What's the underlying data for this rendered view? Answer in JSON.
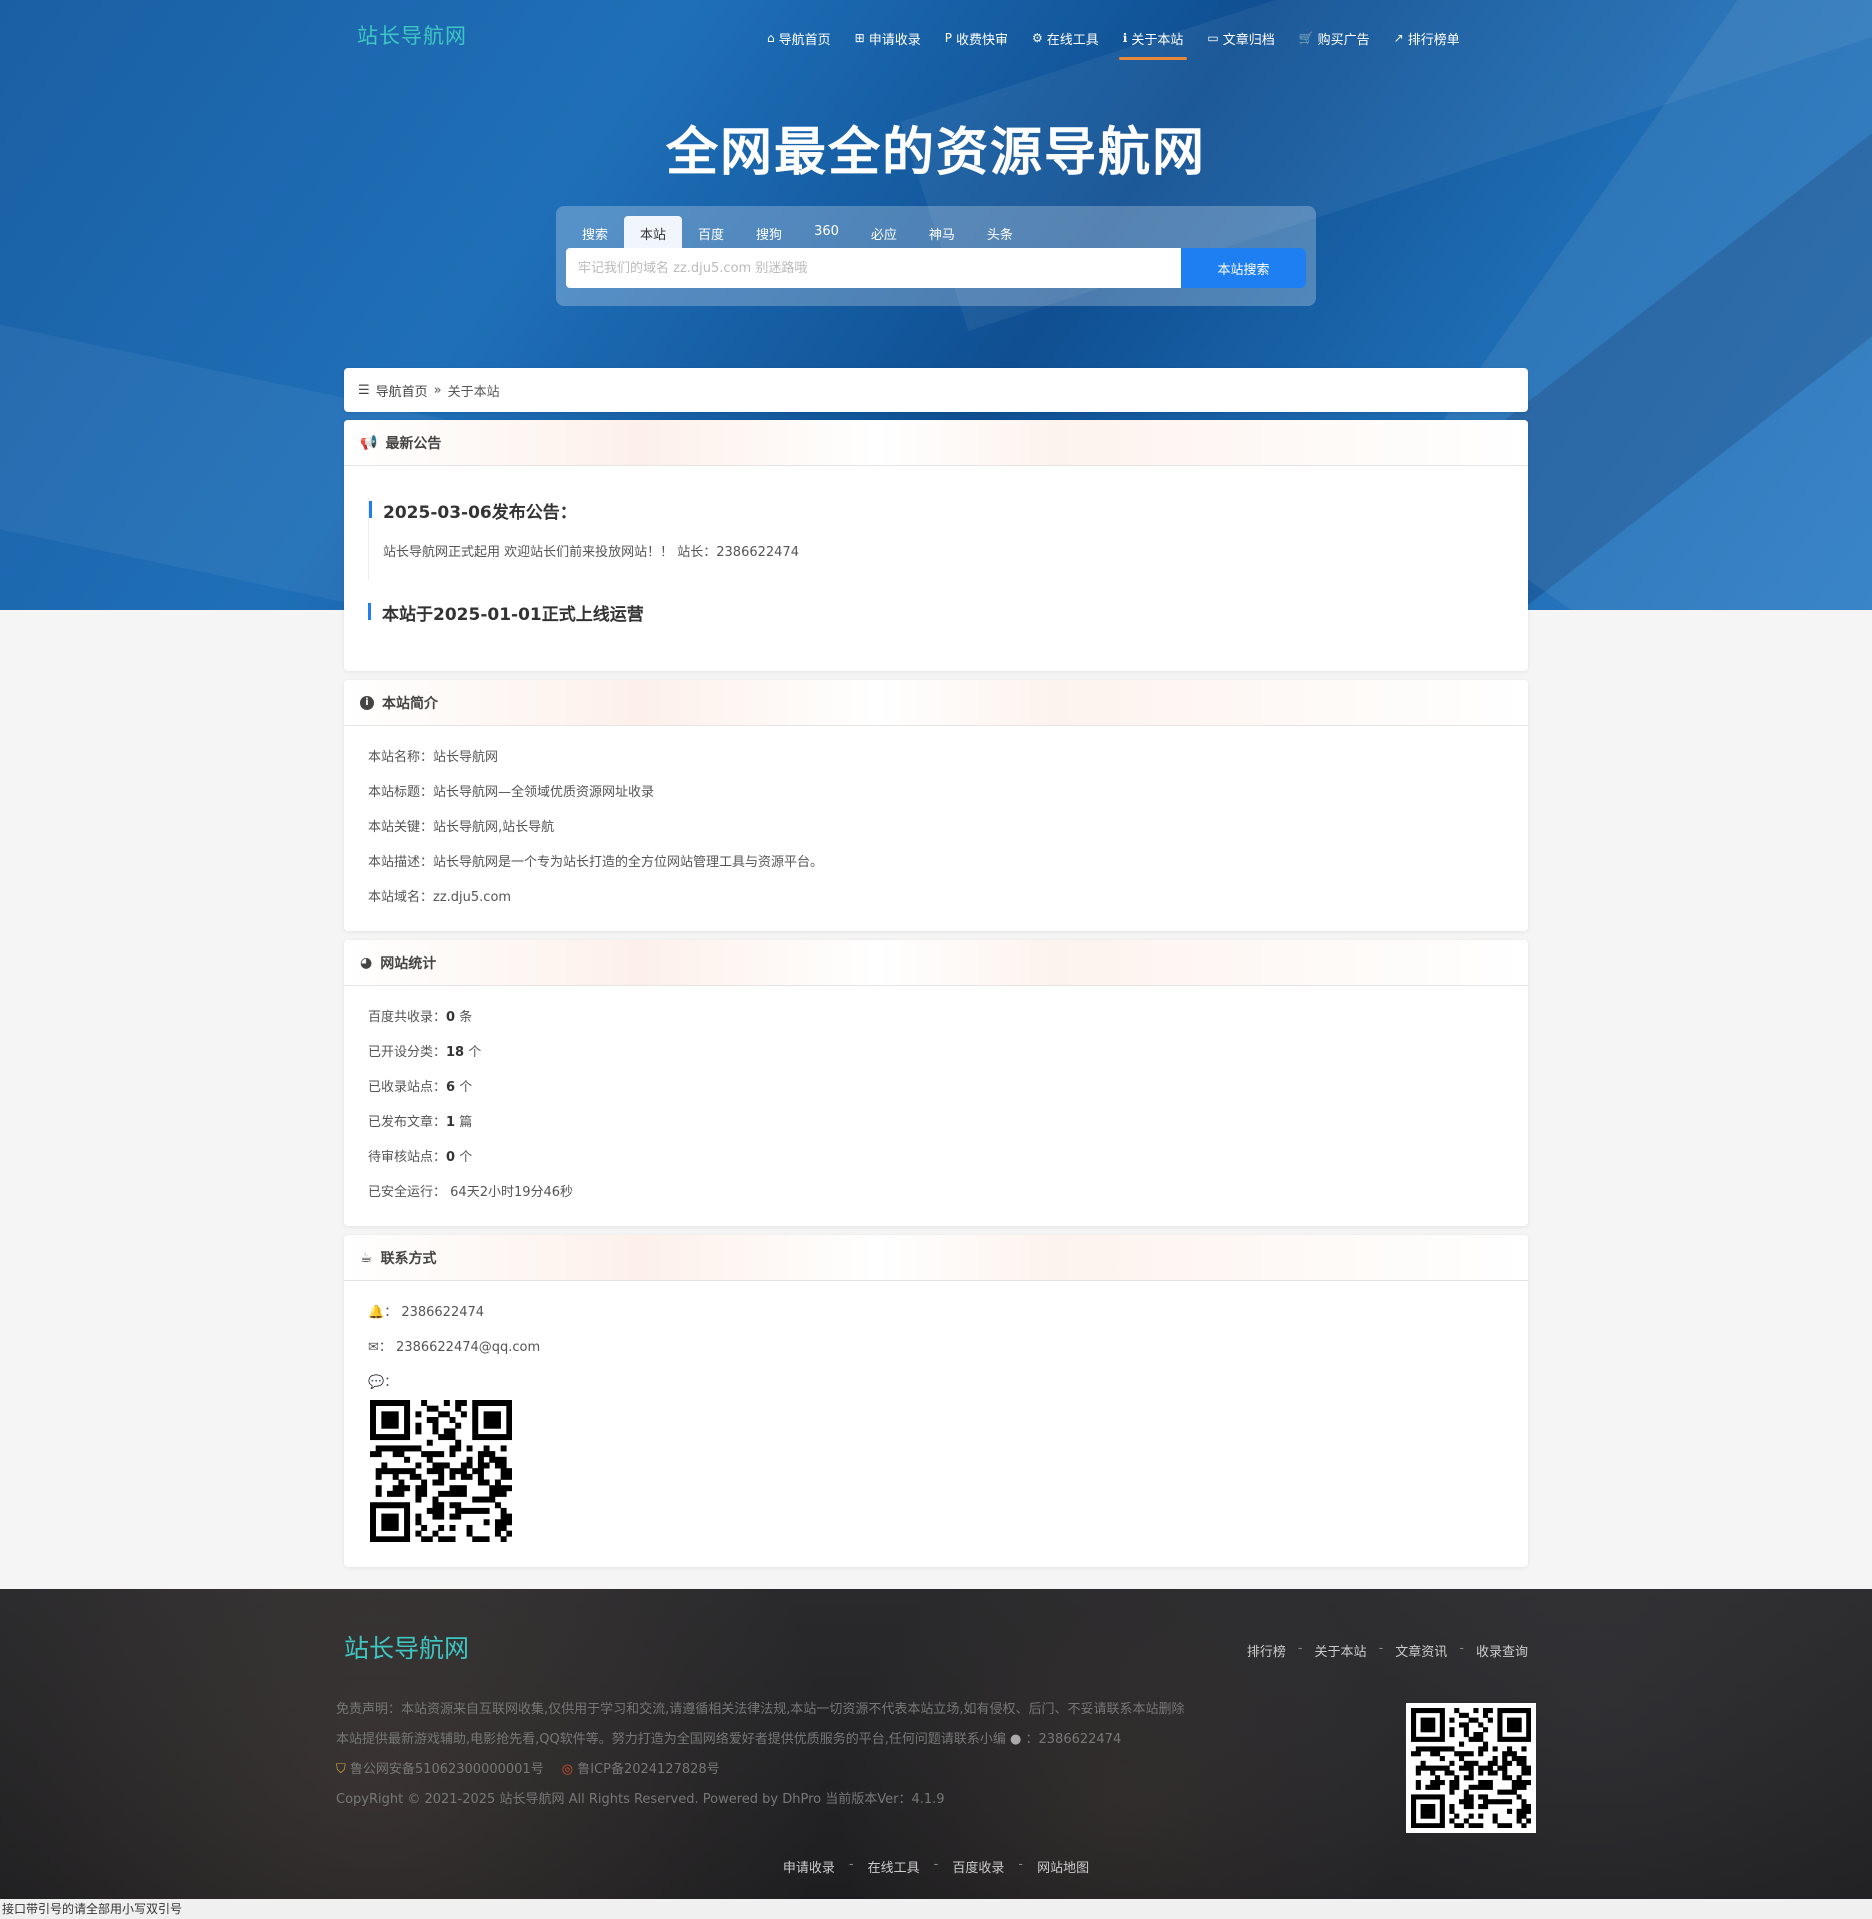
{
  "header": {
    "logo": "站长导航网",
    "nav": [
      {
        "icon": "home-icon",
        "glyph": "⌂",
        "label": "导航首页"
      },
      {
        "icon": "plus-square-icon",
        "glyph": "⊞",
        "label": "申请收录"
      },
      {
        "icon": "paypal-icon",
        "glyph": "P",
        "label": "收费快审"
      },
      {
        "icon": "gears-icon",
        "glyph": "⚙",
        "label": "在线工具"
      },
      {
        "icon": "info-circle-icon",
        "glyph": "ℹ",
        "label": "关于本站"
      },
      {
        "icon": "folder-open-icon",
        "glyph": "▭",
        "label": "文章归档"
      },
      {
        "icon": "cart-icon",
        "glyph": "🛒",
        "label": "购买广告"
      },
      {
        "icon": "line-chart-icon",
        "glyph": "↗",
        "label": "排行榜单"
      }
    ]
  },
  "hero": {
    "title": "全网最全的资源导航网"
  },
  "search": {
    "tabs": [
      "搜索",
      "本站",
      "百度",
      "搜狗",
      "360",
      "必应",
      "神马",
      "头条"
    ],
    "placeholder": "牢记我们的域名 zz.dju5.com 别迷路哦",
    "button": "本站搜索"
  },
  "breadcrumb": {
    "home": "导航首页",
    "sep": "»",
    "current": "关于本站"
  },
  "notice": {
    "title": "最新公告",
    "items": [
      {
        "heading": "2025-03-06发布公告：",
        "text": "站长导航网正式起用 欢迎站长们前来投放网站！！ 站长：2386622474"
      },
      {
        "heading": "本站于2025-01-01正式上线运营",
        "text": ""
      }
    ]
  },
  "intro": {
    "title": "本站简介",
    "lines": [
      {
        "label": "本站名称：",
        "value": "站长导航网"
      },
      {
        "label": "本站标题：",
        "value": "站长导航网—全领域优质资源网址收录"
      },
      {
        "label": "本站关键：",
        "value": "站长导航网,站长导航"
      },
      {
        "label": "本站描述：",
        "value": "站长导航网是一个专为站长打造的全方位网站管理工具与资源平台。"
      },
      {
        "label": "本站域名：",
        "value": "zz.dju5.com"
      }
    ]
  },
  "stats": {
    "title": "网站统计",
    "lines": [
      {
        "label": "百度共收录：",
        "value": "0",
        "unit": "条"
      },
      {
        "label": "已开设分类：",
        "value": "18",
        "unit": "个"
      },
      {
        "label": "已收录站点：",
        "value": "6",
        "unit": "个"
      },
      {
        "label": "已发布文章：",
        "value": "1",
        "unit": "篇"
      },
      {
        "label": "待审核站点：",
        "value": "0",
        "unit": "个"
      },
      {
        "label": "已安全运行：",
        "value": "",
        "unit": "64天2小时19分46秒"
      }
    ]
  },
  "contact": {
    "title": "联系方式",
    "qq": "2386622474",
    "email": "2386622474@qq.com",
    "wechat_label": "："
  },
  "footer": {
    "logo": "站长导航网",
    "links": [
      "排行榜",
      "关于本站",
      "文章资讯",
      "收录查询"
    ],
    "disclaimer": "免责声明：本站资源来自互联网收集,仅供用于学习和交流,请遵循相关法律法规,本站一切资源不代表本站立场,如有侵权、后门、不妥请联系本站删除",
    "about_line": "本站提供最新游戏辅助,电影抢先看,QQ软件等。努力打造为全国网络爱好者提供优质服务的平台,任何问题请联系小编",
    "about_qq": "：2386622474",
    "police": "鲁公网安备51062300000001号",
    "icp": "鲁ICP备2024127828号",
    "copyright": "CopyRight © 2021-2025 站长导航网 All Rights Reserved. Powered by DhPro 当前版本Ver：4.1.9",
    "bottom_links": [
      "申请收录",
      "在线工具",
      "百度收录",
      "网站地图"
    ]
  },
  "status_bar": "接口带引号的请全部用小写双引号",
  "colors": {
    "accent": "#1e7ff3",
    "logo": "#3ec6c2",
    "active_underline": "#e8883a"
  }
}
